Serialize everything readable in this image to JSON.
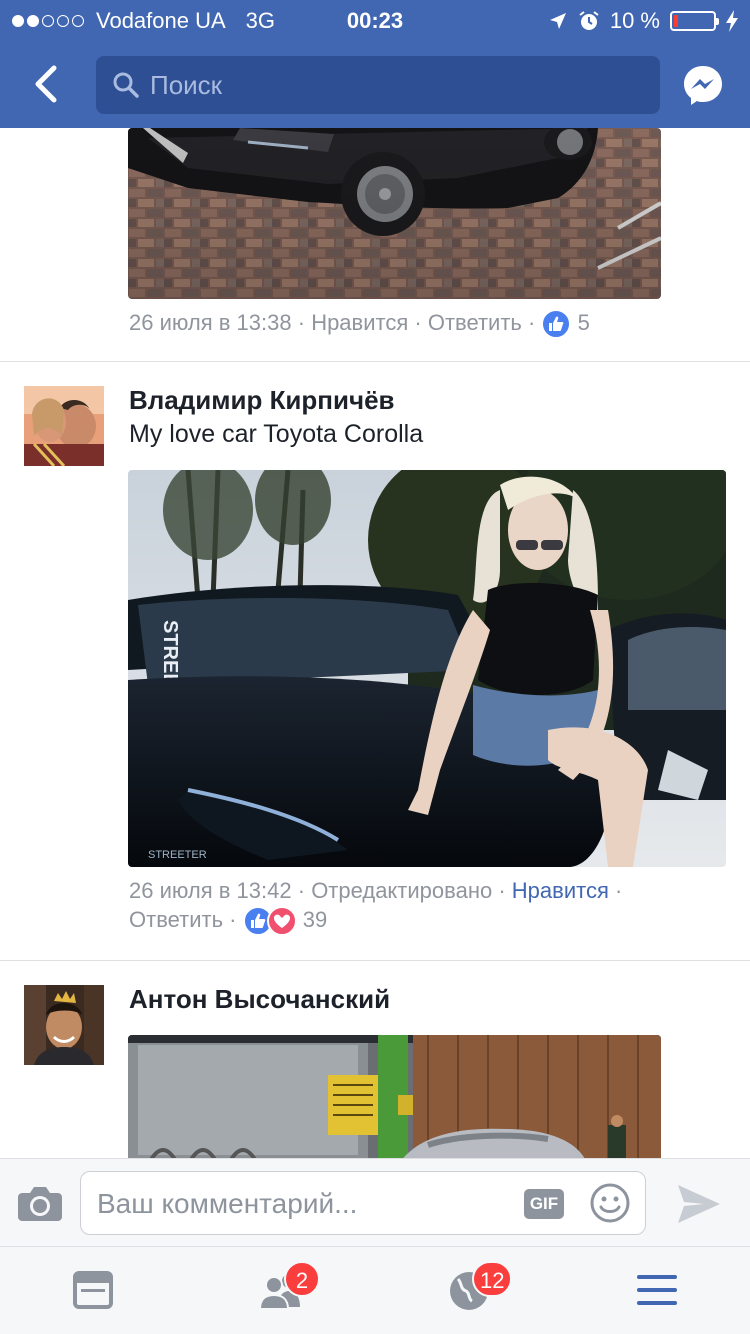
{
  "status_bar": {
    "carrier": "Vodafone UA",
    "network": "3G",
    "time": "00:23",
    "battery": "10 %",
    "battery_level": 0.1,
    "signal_bars_filled": 2,
    "signal_bars_total": 5
  },
  "nav": {
    "search_placeholder": "Поиск",
    "back_icon": "chevron-left-icon",
    "messenger_icon": "messenger-icon"
  },
  "comments": [
    {
      "time": "26 июля в 13:38",
      "like_label": "Нравится",
      "reply_label": "Ответить",
      "reaction_count": "5",
      "reactions": [
        "like"
      ]
    },
    {
      "author": "Владимир Кирпичёв",
      "text": "My love car Toyota Corolla",
      "time": "26 июля в 13:42",
      "edited_label": "Отредактировано",
      "like_label": "Нравится",
      "reply_label": "Ответить",
      "reaction_count": "39",
      "reactions": [
        "like",
        "love"
      ]
    },
    {
      "author": "Антон Высочанский"
    }
  ],
  "composer": {
    "placeholder": "Ваш комментарий...",
    "gif_label": "GIF"
  },
  "tabbar": {
    "friends_badge": "2",
    "notifications_badge": "12"
  },
  "colors": {
    "brand": "#4267b2",
    "meta_text": "#90949c",
    "badge": "#fa3e3e",
    "like": "#4a7ff0",
    "love": "#f0506e"
  }
}
